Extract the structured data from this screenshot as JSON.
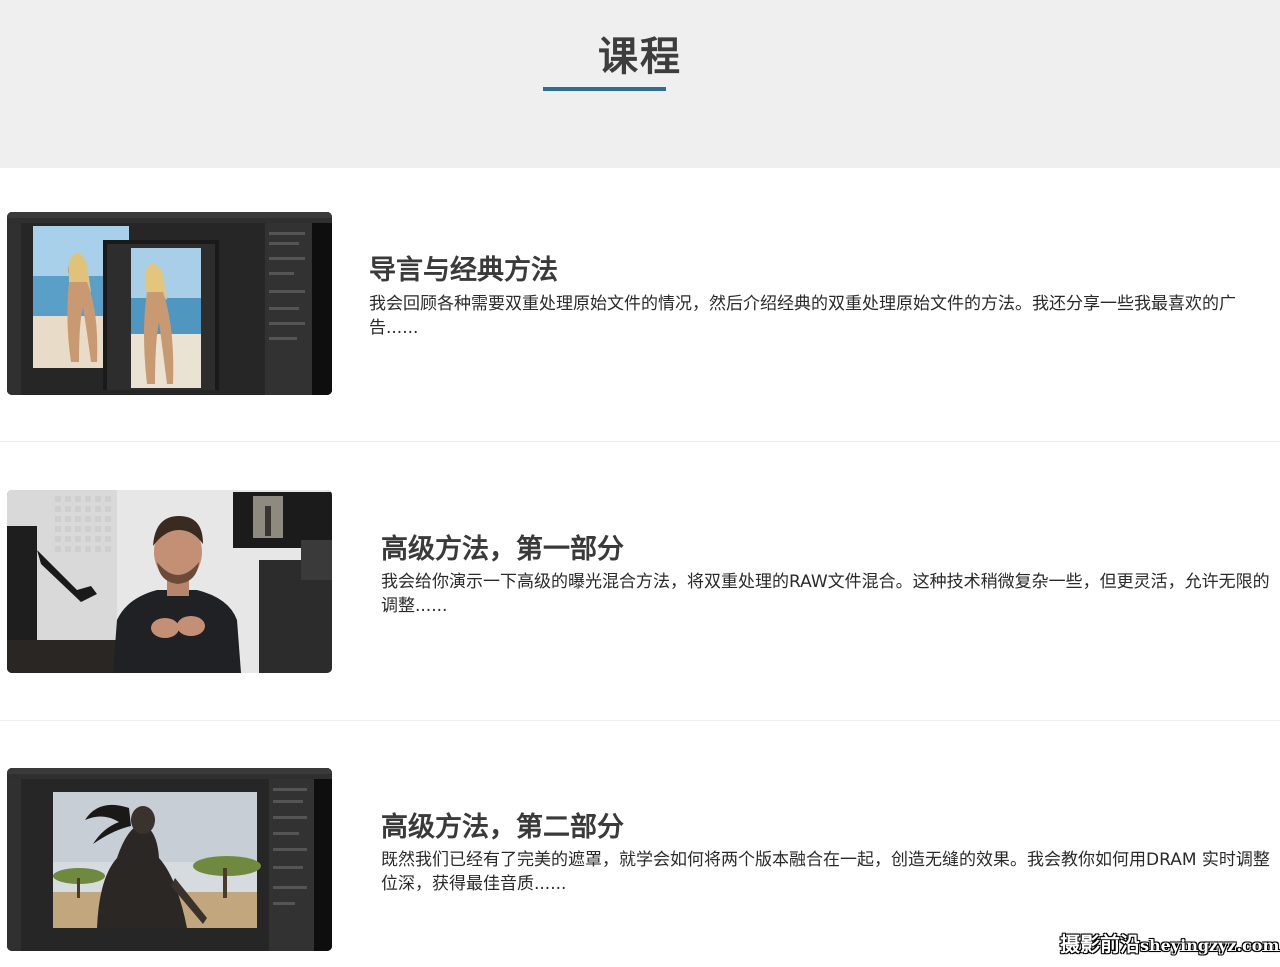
{
  "header": {
    "title": "课程"
  },
  "lessons": [
    {
      "title": "导言与经典方法",
      "description": "我会回顾各种需要双重处理原始文件的情况，然后介绍经典的双重处理原始文件的方法。我还分享一些我最喜欢的广告......"
    },
    {
      "title": "高级方法，第一部分",
      "description": "我会给你演示一下高级的曝光混合方法，将双重处理的RAW文件混合。这种技术稍微复杂一些，但更灵活，允许无限的调整......"
    },
    {
      "title": "高级方法，第二部分",
      "description": "既然我们已经有了完美的遮罩，就学会如何将两个版本融合在一起，创造无缝的效果。我会教你如何用DRAM 实时调整位深，获得最佳音质......"
    }
  ],
  "watermark": {
    "cn": "摄影前沿",
    "latin": "sheyingzyz.com"
  }
}
